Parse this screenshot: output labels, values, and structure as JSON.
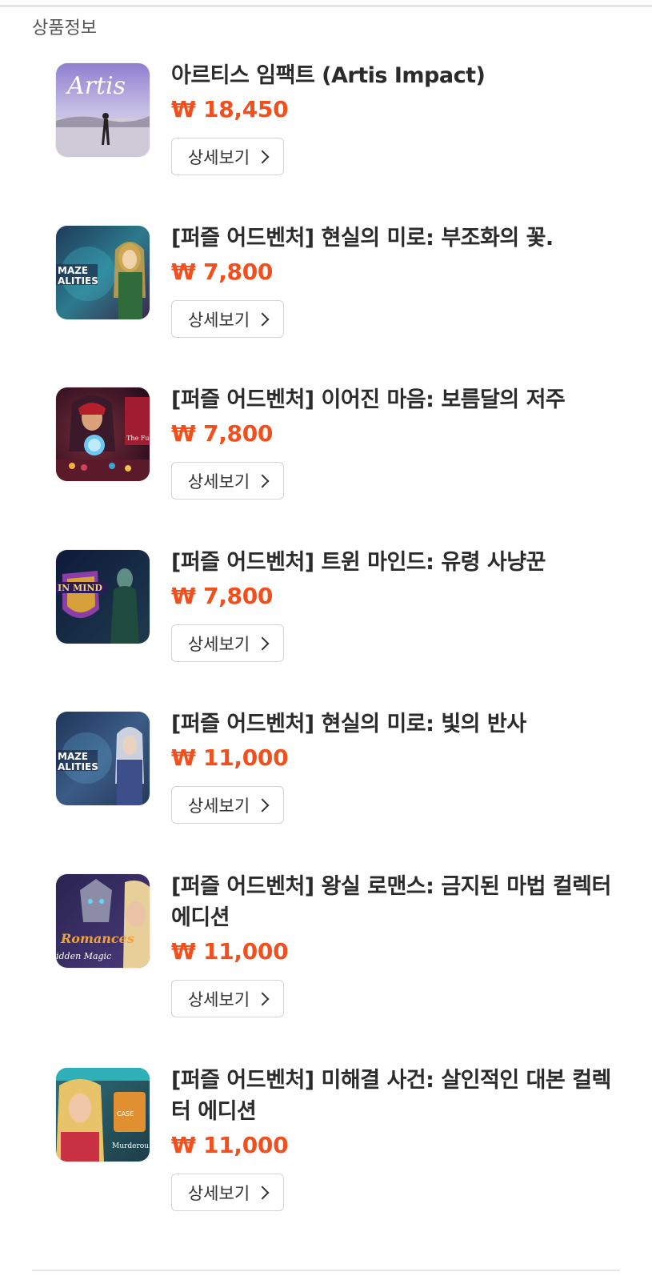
{
  "section": {
    "title": "상품정보"
  },
  "products": [
    {
      "title": "아르티스 임팩트 (Artis Impact)",
      "price": "₩ 18,450",
      "button": "상세보기",
      "icon": "artis-impact-thumbnail"
    },
    {
      "title": "[퍼즐 어드벤처] 현실의 미로: 부조화의 꽃.",
      "price": "₩ 7,800",
      "button": "상세보기",
      "icon": "maze-of-realities-thumbnail"
    },
    {
      "title": "[퍼즐 어드벤처] 이어진 마음: 보름달의 저주",
      "price": "₩ 7,800",
      "button": "상세보기",
      "icon": "fortune-teller-thumbnail"
    },
    {
      "title": "[퍼즐 어드벤처] 트윈 마인드: 유령 사냥꾼",
      "price": "₩ 7,800",
      "button": "상세보기",
      "icon": "twin-mind-thumbnail"
    },
    {
      "title": "[퍼즐 어드벤처] 현실의 미로: 빛의 반사",
      "price": "₩ 11,000",
      "button": "상세보기",
      "icon": "maze-of-realities-thumbnail"
    },
    {
      "title": "[퍼즐 어드벤처] 왕실 로맨스: 금지된 마법 컬렉터 에디션",
      "price": "₩ 11,000",
      "button": "상세보기",
      "icon": "royal-romances-thumbnail"
    },
    {
      "title": "[퍼즐 어드벤처] 미해결 사건: 살인적인 대본 컬렉터 에디션",
      "price": "₩ 11,000",
      "button": "상세보기",
      "icon": "unsolved-case-thumbnail"
    }
  ],
  "colors": {
    "price": "#f04f1e",
    "title": "#2b2b2b",
    "border": "#d4d4d4"
  }
}
